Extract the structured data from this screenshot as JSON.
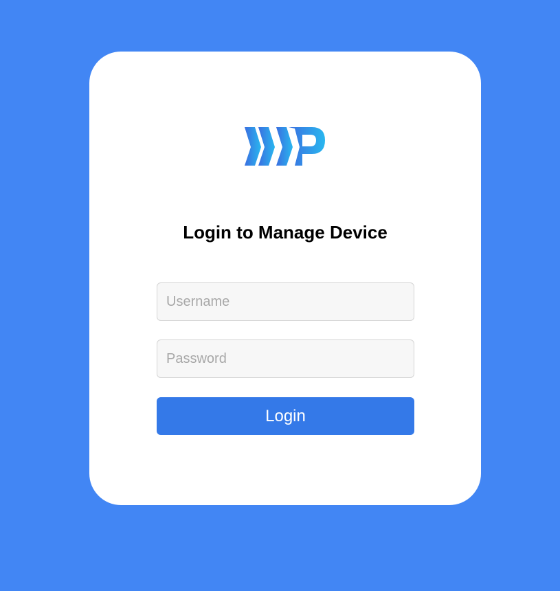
{
  "colors": {
    "background": "#4286f4",
    "card": "#ffffff",
    "button": "#3479e8",
    "logo_gradient_start": "#3a6fe0",
    "logo_gradient_end": "#29b7ef"
  },
  "logo": {
    "icon": "brand-logo-icon"
  },
  "login": {
    "title": "Login to Manage Device",
    "username_placeholder": "Username",
    "password_placeholder": "Password",
    "button_label": "Login"
  }
}
